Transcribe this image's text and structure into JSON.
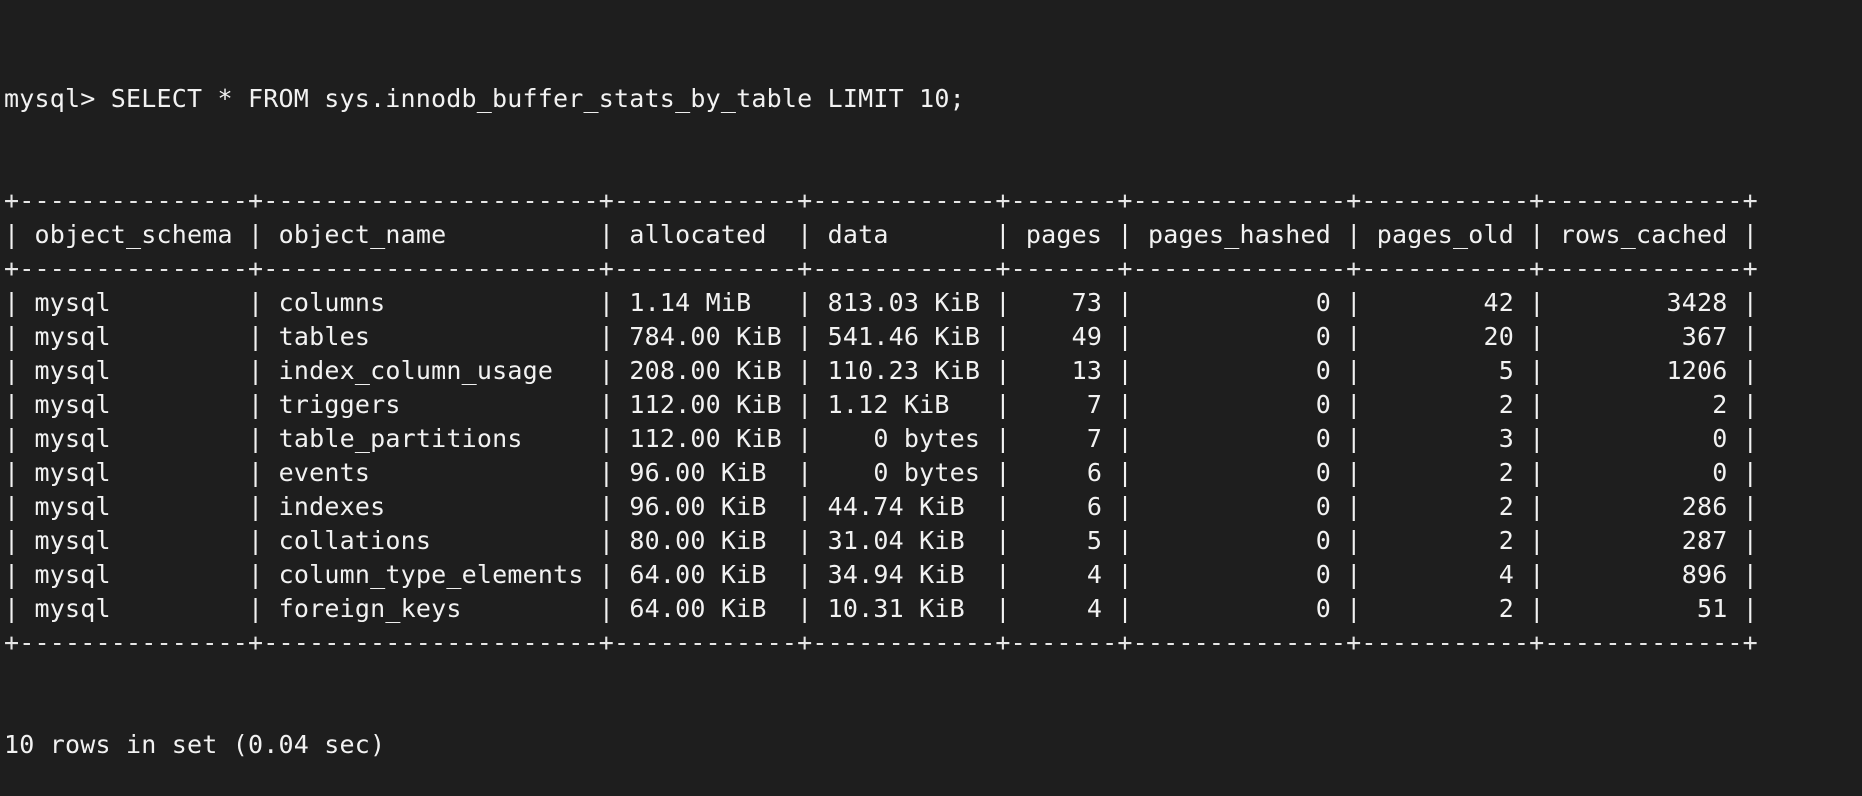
{
  "terminal": {
    "prompt": "mysql> ",
    "command": "SELECT * FROM sys.innodb_buffer_stats_by_table LIMIT 10;",
    "columns": [
      {
        "name": "object_schema",
        "align": "left"
      },
      {
        "name": "object_name",
        "align": "left"
      },
      {
        "name": "allocated",
        "align": "left"
      },
      {
        "name": "data",
        "align": "left"
      },
      {
        "name": "pages",
        "align": "right"
      },
      {
        "name": "pages_hashed",
        "align": "right"
      },
      {
        "name": "pages_old",
        "align": "right"
      },
      {
        "name": "rows_cached",
        "align": "right"
      }
    ],
    "rows": [
      [
        "mysql",
        "columns",
        "1.14 MiB",
        "813.03 KiB",
        "73",
        "0",
        "42",
        "3428"
      ],
      [
        "mysql",
        "tables",
        "784.00 KiB",
        "541.46 KiB",
        "49",
        "0",
        "20",
        "367"
      ],
      [
        "mysql",
        "index_column_usage",
        "208.00 KiB",
        "110.23 KiB",
        "13",
        "0",
        "5",
        "1206"
      ],
      [
        "mysql",
        "triggers",
        "112.00 KiB",
        "1.12 KiB",
        "7",
        "0",
        "2",
        "2"
      ],
      [
        "mysql",
        "table_partitions",
        "112.00 KiB",
        "   0 bytes",
        "7",
        "0",
        "3",
        "0"
      ],
      [
        "mysql",
        "events",
        "96.00 KiB",
        "   0 bytes",
        "6",
        "0",
        "2",
        "0"
      ],
      [
        "mysql",
        "indexes",
        "96.00 KiB",
        "44.74 KiB",
        "6",
        "0",
        "2",
        "286"
      ],
      [
        "mysql",
        "collations",
        "80.00 KiB",
        "31.04 KiB",
        "5",
        "0",
        "2",
        "287"
      ],
      [
        "mysql",
        "column_type_elements",
        "64.00 KiB",
        "34.94 KiB",
        "4",
        "0",
        "4",
        "896"
      ],
      [
        "mysql",
        "foreign_keys",
        "64.00 KiB",
        "10.31 KiB",
        "4",
        "0",
        "2",
        "51"
      ]
    ],
    "result_summary": "10 rows in set (0.04 sec)"
  }
}
